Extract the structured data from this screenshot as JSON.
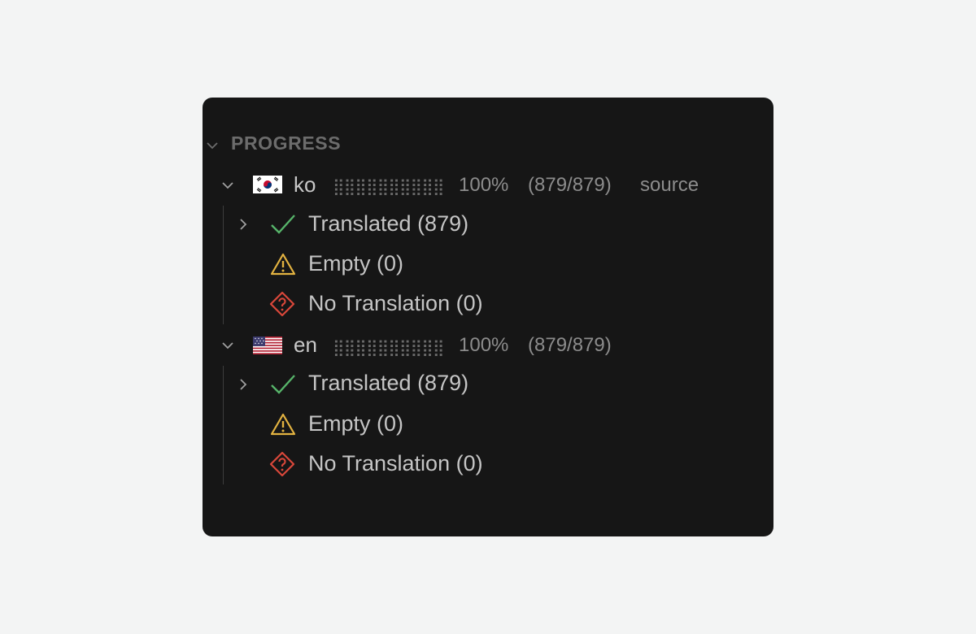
{
  "panel": {
    "section_title": "PROGRESS",
    "colors": {
      "background": "#161616",
      "check": "#57b46a",
      "warning": "#e3b341",
      "error": "#d9473a"
    }
  },
  "languages": [
    {
      "code": "ko",
      "flag_icon": "south-korea-flag-icon",
      "progress_bar": "⣿⣿⣿⣿⣿⣿⣿⣿⣿⣿",
      "progress_percent": 100,
      "percent": "100%",
      "counts": "(879/879)",
      "tag": "source",
      "items": [
        {
          "icon": "check-icon",
          "label": "Translated (879)",
          "expandable": true
        },
        {
          "icon": "warning-icon",
          "label": "Empty (0)",
          "expandable": false
        },
        {
          "icon": "question-diamond-icon",
          "label": "No Translation (0)",
          "expandable": false
        }
      ]
    },
    {
      "code": "en",
      "flag_icon": "us-flag-icon",
      "progress_bar": "⣿⣿⣿⣿⣿⣿⣿⣿⣿⣿",
      "progress_percent": 100,
      "percent": "100%",
      "counts": "(879/879)",
      "tag": "",
      "items": [
        {
          "icon": "check-icon",
          "label": "Translated (879)",
          "expandable": true
        },
        {
          "icon": "warning-icon",
          "label": "Empty (0)",
          "expandable": false
        },
        {
          "icon": "question-diamond-icon",
          "label": "No Translation (0)",
          "expandable": false
        }
      ]
    }
  ]
}
